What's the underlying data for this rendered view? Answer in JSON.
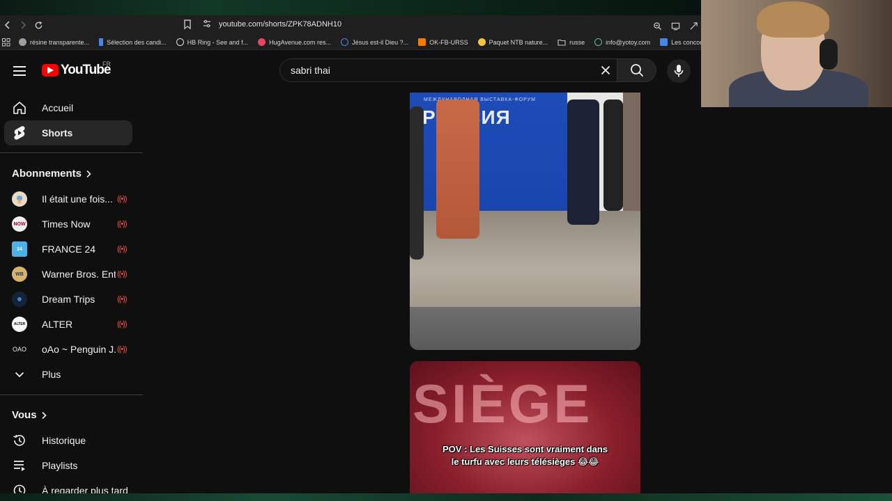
{
  "browser": {
    "url": "youtube.com/shorts/ZPK78ADNH10",
    "bookmarks": [
      {
        "label": "résine transparente...",
        "color": "#9aa0a6"
      },
      {
        "label": "Sélection des candi...",
        "color": "#4a86e8"
      },
      {
        "label": "HB Ring - See and f...",
        "color": "#dddddd"
      },
      {
        "label": "HugAvenue.com res...",
        "color": "#e94560"
      },
      {
        "label": "Jésus est-il Dieu ?...",
        "color": "#4a86e8"
      },
      {
        "label": "OK-FB-URSS",
        "color": "#f57c00"
      },
      {
        "label": "Paquet NTB nature...",
        "color": "#f4c542"
      },
      {
        "label": "russe",
        "color": "#9aa0a6"
      },
      {
        "label": "info@yotoy.com",
        "color": "#5fb88c"
      },
      {
        "label": "Les concours d'au",
        "color": "#4a86e8"
      }
    ]
  },
  "header": {
    "logo_text": "YouTube",
    "region": "FR",
    "search_value": "sabri thai"
  },
  "sidebar": {
    "main": [
      {
        "label": "Accueil",
        "icon": "home-icon"
      },
      {
        "label": "Shorts",
        "icon": "shorts-icon"
      }
    ],
    "subscriptions_title": "Abonnements",
    "subscriptions": [
      {
        "label": "Il était une fois... ...",
        "avatar_color": "#e8dcc8",
        "avatar_text": ""
      },
      {
        "label": "Times Now",
        "avatar_color": "#f0f0f0",
        "avatar_text": "NOW"
      },
      {
        "label": "FRANCE 24",
        "avatar_color": "#4ab3e8",
        "avatar_text": "24"
      },
      {
        "label": "Warner Bros. Ent...",
        "avatar_color": "#d9b36a",
        "avatar_text": "WB"
      },
      {
        "label": "Dream Trips",
        "avatar_color": "#12243a",
        "avatar_text": ""
      },
      {
        "label": "ALTER",
        "avatar_color": "#ffffff",
        "avatar_text": "ALTER"
      },
      {
        "label": "oAo ~ Penguin J...",
        "avatar_color": "#0f0f0f",
        "avatar_text": "OAO"
      }
    ],
    "more_label": "Plus",
    "you_title": "Vous",
    "you": [
      {
        "label": "Historique",
        "icon": "history-icon"
      },
      {
        "label": "Playlists",
        "icon": "playlists-icon"
      },
      {
        "label": "À regarder plus tard",
        "icon": "watch-later-icon"
      }
    ]
  },
  "shorts": [
    {
      "banner_small": "МЕЖДУНАРОДНАЯ ВЫСТАВКА-ФОРУМ",
      "banner": "РОССИЯ"
    },
    {
      "overlay": "SIÈGE",
      "caption_line1": "POV : Les Suisses sont vraiment dans",
      "caption_line2": "le turfu avec leurs télésièges 😂😂"
    }
  ]
}
